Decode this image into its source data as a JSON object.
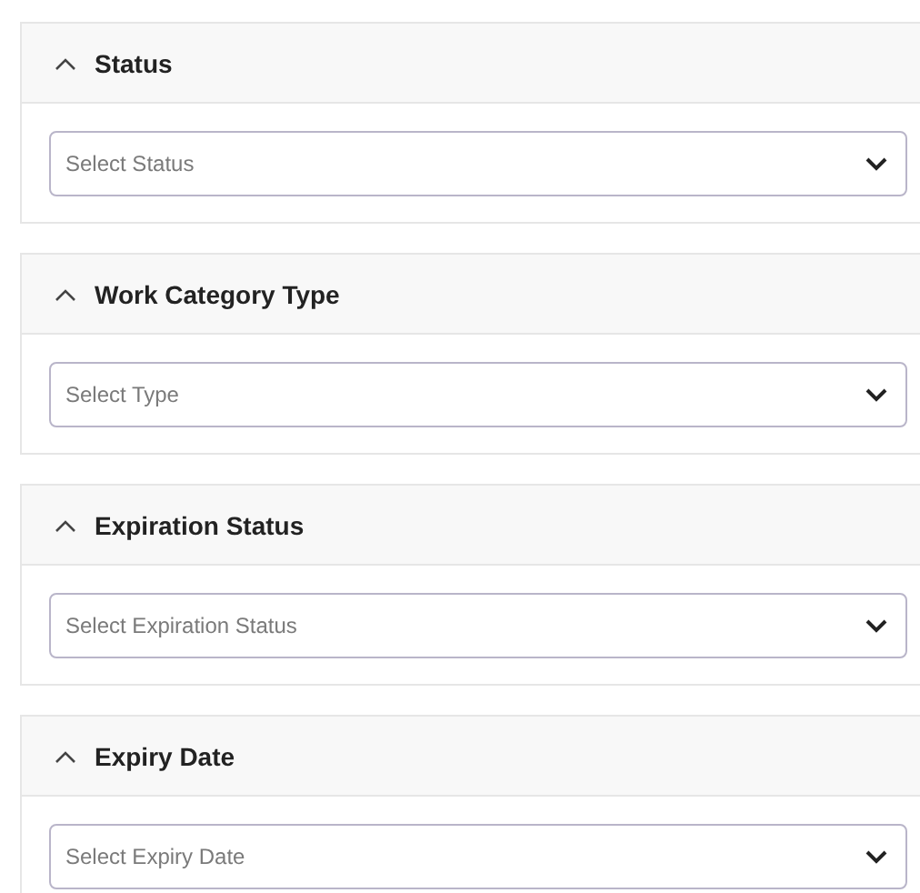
{
  "filters": [
    {
      "title": "Status",
      "expanded": true,
      "select": {
        "placeholder": "Select Status"
      }
    },
    {
      "title": "Work Category Type",
      "expanded": true,
      "select": {
        "placeholder": "Select Type"
      }
    },
    {
      "title": "Expiration Status",
      "expanded": true,
      "select": {
        "placeholder": "Select Expiration Status"
      }
    },
    {
      "title": "Expiry Date",
      "expanded": true,
      "select": {
        "placeholder": "Select Expiry Date"
      }
    }
  ]
}
